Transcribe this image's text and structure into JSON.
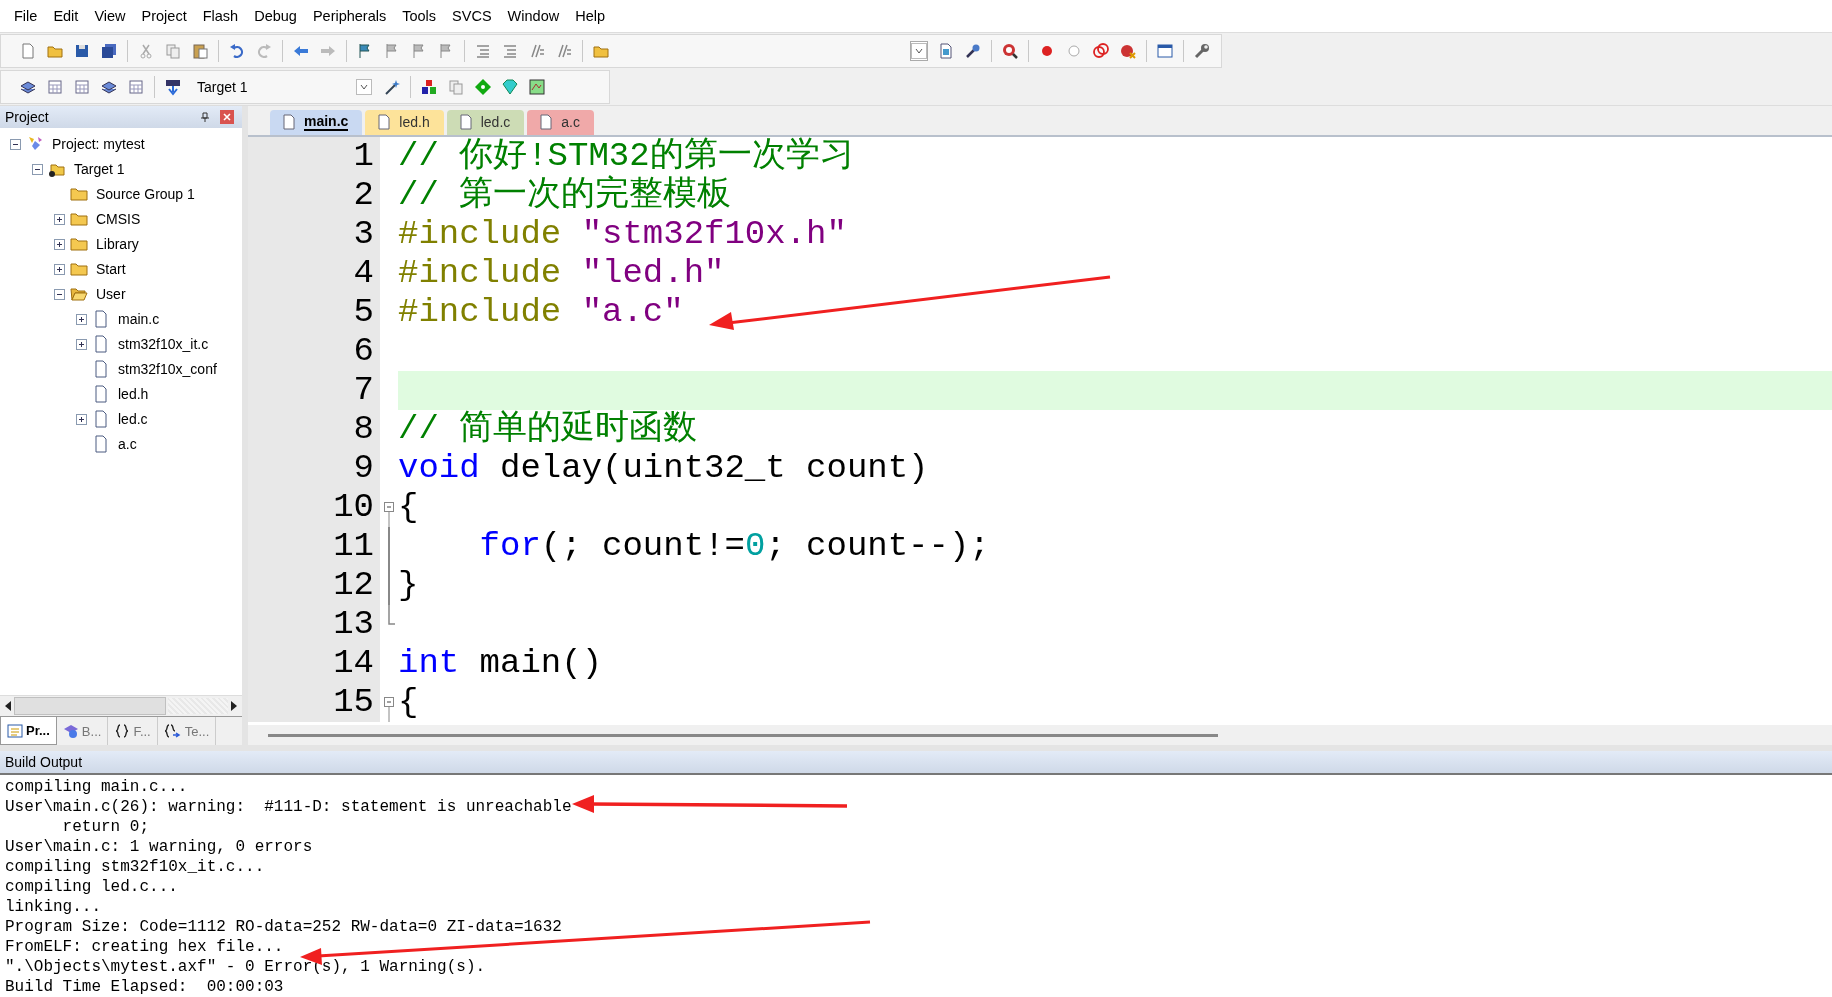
{
  "menu": [
    "File",
    "Edit",
    "View",
    "Project",
    "Flash",
    "Debug",
    "Peripherals",
    "Tools",
    "SVCS",
    "Window",
    "Help"
  ],
  "toolbar": {
    "target": "Target 1"
  },
  "project_panel": {
    "title": "Project",
    "tree": [
      {
        "label": "Project: mytest",
        "kind": "project",
        "expanded": true,
        "children": [
          {
            "label": "Target 1",
            "kind": "target",
            "expanded": true,
            "children": [
              {
                "label": "Source Group 1",
                "kind": "folder"
              },
              {
                "label": "CMSIS",
                "kind": "folder",
                "expanded": false
              },
              {
                "label": "Library",
                "kind": "folder",
                "expanded": false
              },
              {
                "label": "Start",
                "kind": "folder",
                "expanded": false
              },
              {
                "label": "User",
                "kind": "folder",
                "expanded": true,
                "children": [
                  {
                    "label": "main.c",
                    "kind": "file",
                    "expanded": false
                  },
                  {
                    "label": "stm32f10x_it.c",
                    "kind": "file",
                    "expanded": false
                  },
                  {
                    "label": "stm32f10x_conf",
                    "kind": "file"
                  },
                  {
                    "label": "led.h",
                    "kind": "file"
                  },
                  {
                    "label": "led.c",
                    "kind": "file",
                    "expanded": false
                  },
                  {
                    "label": "a.c",
                    "kind": "file"
                  }
                ]
              }
            ]
          }
        ]
      }
    ],
    "tabs": [
      {
        "label": "Pr...",
        "kind": "project",
        "selected": true
      },
      {
        "label": "B...",
        "kind": "books",
        "selected": false
      },
      {
        "label": "F...",
        "kind": "functions",
        "selected": false
      },
      {
        "label": "Te...",
        "kind": "templates",
        "selected": false
      }
    ]
  },
  "editor": {
    "tabs": [
      {
        "label": "main.c",
        "selected": true,
        "color": "#c9d9f2"
      },
      {
        "label": "led.h",
        "selected": false,
        "color": "#fde39a"
      },
      {
        "label": "led.c",
        "selected": false,
        "color": "#cddcb5"
      },
      {
        "label": "a.c",
        "selected": false,
        "color": "#f0a9a9"
      }
    ],
    "lines": [
      {
        "number": "1",
        "current": false,
        "tokens": [
          {
            "kind": "comment",
            "text": "// 你好!STM32的第一次学习"
          }
        ]
      },
      {
        "number": "2",
        "current": false,
        "tokens": [
          {
            "kind": "comment",
            "text": "// 第一次的完整模板"
          }
        ]
      },
      {
        "number": "3",
        "current": false,
        "tokens": [
          {
            "kind": "preproc",
            "text": "#include "
          },
          {
            "kind": "string",
            "text": "\"stm32f10x.h\""
          }
        ]
      },
      {
        "number": "4",
        "current": false,
        "tokens": [
          {
            "kind": "preproc",
            "text": "#include "
          },
          {
            "kind": "string",
            "text": "\"led.h\""
          }
        ]
      },
      {
        "number": "5",
        "current": false,
        "tokens": [
          {
            "kind": "preproc",
            "text": "#include "
          },
          {
            "kind": "string",
            "text": "\"a.c\""
          }
        ]
      },
      {
        "number": "6",
        "current": false
      },
      {
        "number": "7",
        "current": true
      },
      {
        "number": "8",
        "current": false,
        "tokens": [
          {
            "kind": "comment",
            "text": "// 简单的延时函数"
          }
        ]
      },
      {
        "number": "9",
        "current": false,
        "tokens": [
          {
            "kind": "keyword",
            "text": "void"
          },
          {
            "kind": "plain",
            "text": " delay(uint32_t count)"
          }
        ]
      },
      {
        "number": "10",
        "current": false,
        "fold_start": true,
        "tokens": [
          {
            "kind": "plain",
            "text": "{"
          }
        ]
      },
      {
        "number": "11",
        "current": false,
        "in_fold": true,
        "tokens": [
          {
            "kind": "keyword",
            "text": "    for"
          },
          {
            "kind": "plain",
            "text": "(; count!="
          },
          {
            "kind": "number",
            "text": "0"
          },
          {
            "kind": "plain",
            "text": "; count--);"
          }
        ]
      },
      {
        "number": "12",
        "current": false,
        "in_fold": true,
        "tokens": [
          {
            "kind": "plain",
            "text": "}"
          }
        ]
      },
      {
        "number": "13",
        "current": false,
        "fold_end": true
      },
      {
        "number": "14",
        "current": false,
        "tokens": [
          {
            "kind": "keyword",
            "text": "int"
          },
          {
            "kind": "plain",
            "text": " main()"
          }
        ]
      },
      {
        "number": "15",
        "current": false,
        "fold_start": true,
        "tokens": [
          {
            "kind": "plain",
            "text": "{"
          }
        ]
      }
    ]
  },
  "build_output": {
    "title": "Build Output",
    "lines": [
      "compiling main.c...",
      "User\\main.c(26): warning:  #111-D: statement is unreachable",
      "      return 0;",
      "User\\main.c: 1 warning, 0 errors",
      "compiling stm32f10x_it.c...",
      "compiling led.c...",
      "linking...",
      "Program Size: Code=1112 RO-data=252 RW-data=0 ZI-data=1632",
      "FromELF: creating hex file...",
      "\".\\Objects\\mytest.axf\" - 0 Error(s), 1 Warning(s).",
      "Build Time Elapsed:  00:00:03"
    ]
  }
}
